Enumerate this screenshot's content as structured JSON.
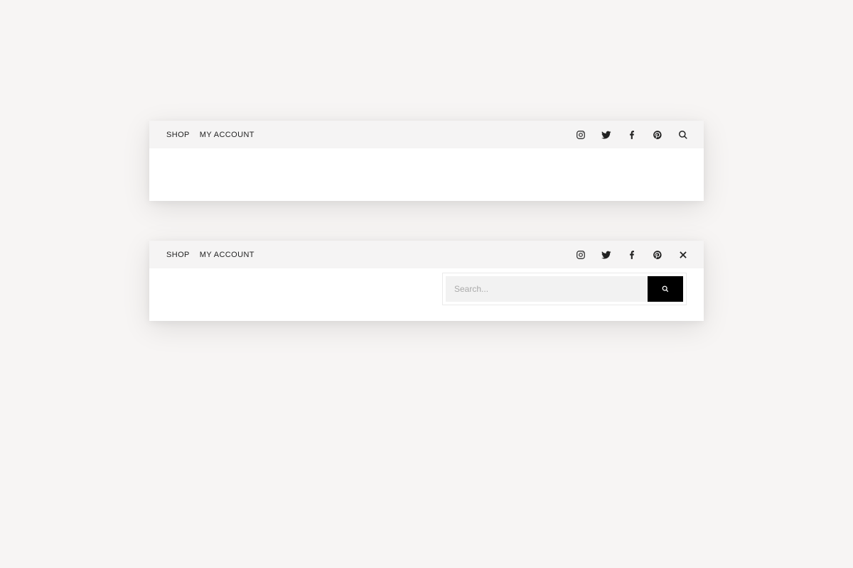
{
  "nav": {
    "shop_label": "SHOP",
    "account_label": "MY ACCOUNT"
  },
  "search": {
    "placeholder": "Search...",
    "value": ""
  }
}
